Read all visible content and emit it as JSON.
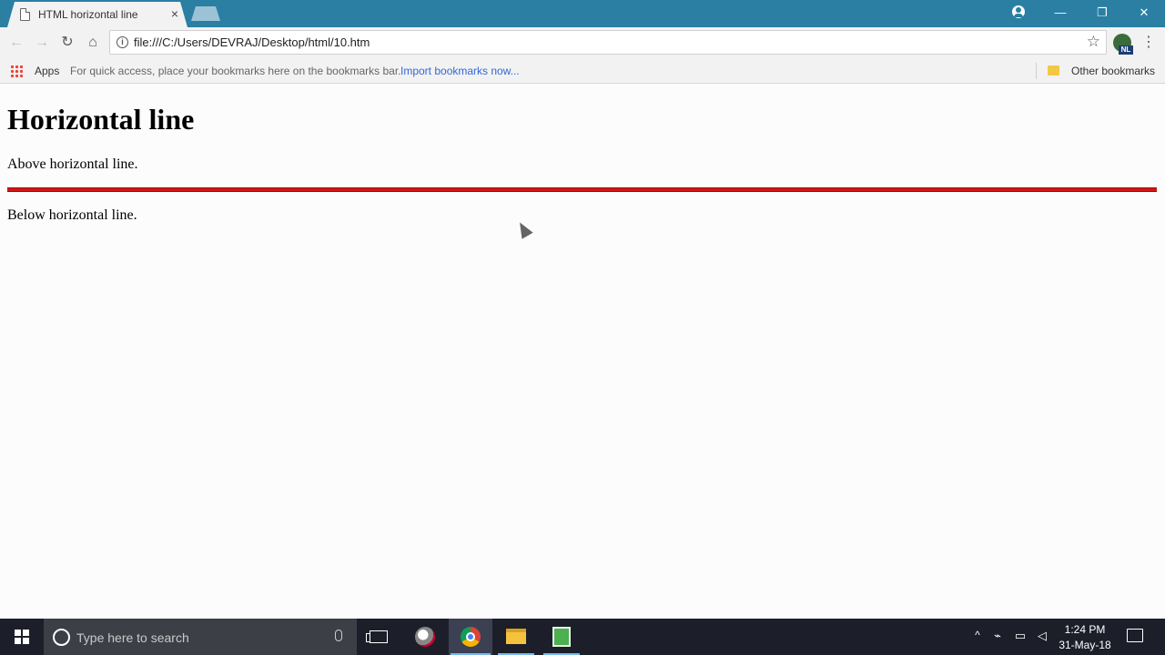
{
  "browser": {
    "tab_title": "HTML horizontal line",
    "tab_close_label": "×",
    "window_minimize": "—",
    "window_restore": "❐",
    "window_close": "✕",
    "url": "file:///C:/Users/DEVRAJ/Desktop/html/10.htm",
    "extension_badge": "NL"
  },
  "bookmarks_bar": {
    "apps_label": "Apps",
    "hint": "For quick access, place your bookmarks here on the bookmarks bar.",
    "import_link": "Import bookmarks now...",
    "other_bookmarks": "Other bookmarks"
  },
  "page": {
    "heading": "Horizontal line",
    "above_text": "Above horizontal line.",
    "below_text": "Below horizontal line.",
    "hr_color": "#d31515"
  },
  "taskbar": {
    "search_placeholder": "Type here to search",
    "time": "1:24 PM",
    "date": "31-May-18"
  },
  "icons": [
    "page-icon",
    "back-icon",
    "forward-icon",
    "reload-icon",
    "home-icon",
    "info-icon",
    "star-icon",
    "menu-icon",
    "apps-icon",
    "folder-icon",
    "windows-icon",
    "cortana-icon",
    "mic-icon",
    "task-view-icon",
    "chrome-icon",
    "file-explorer-icon",
    "notepad-icon",
    "notification-icon"
  ]
}
